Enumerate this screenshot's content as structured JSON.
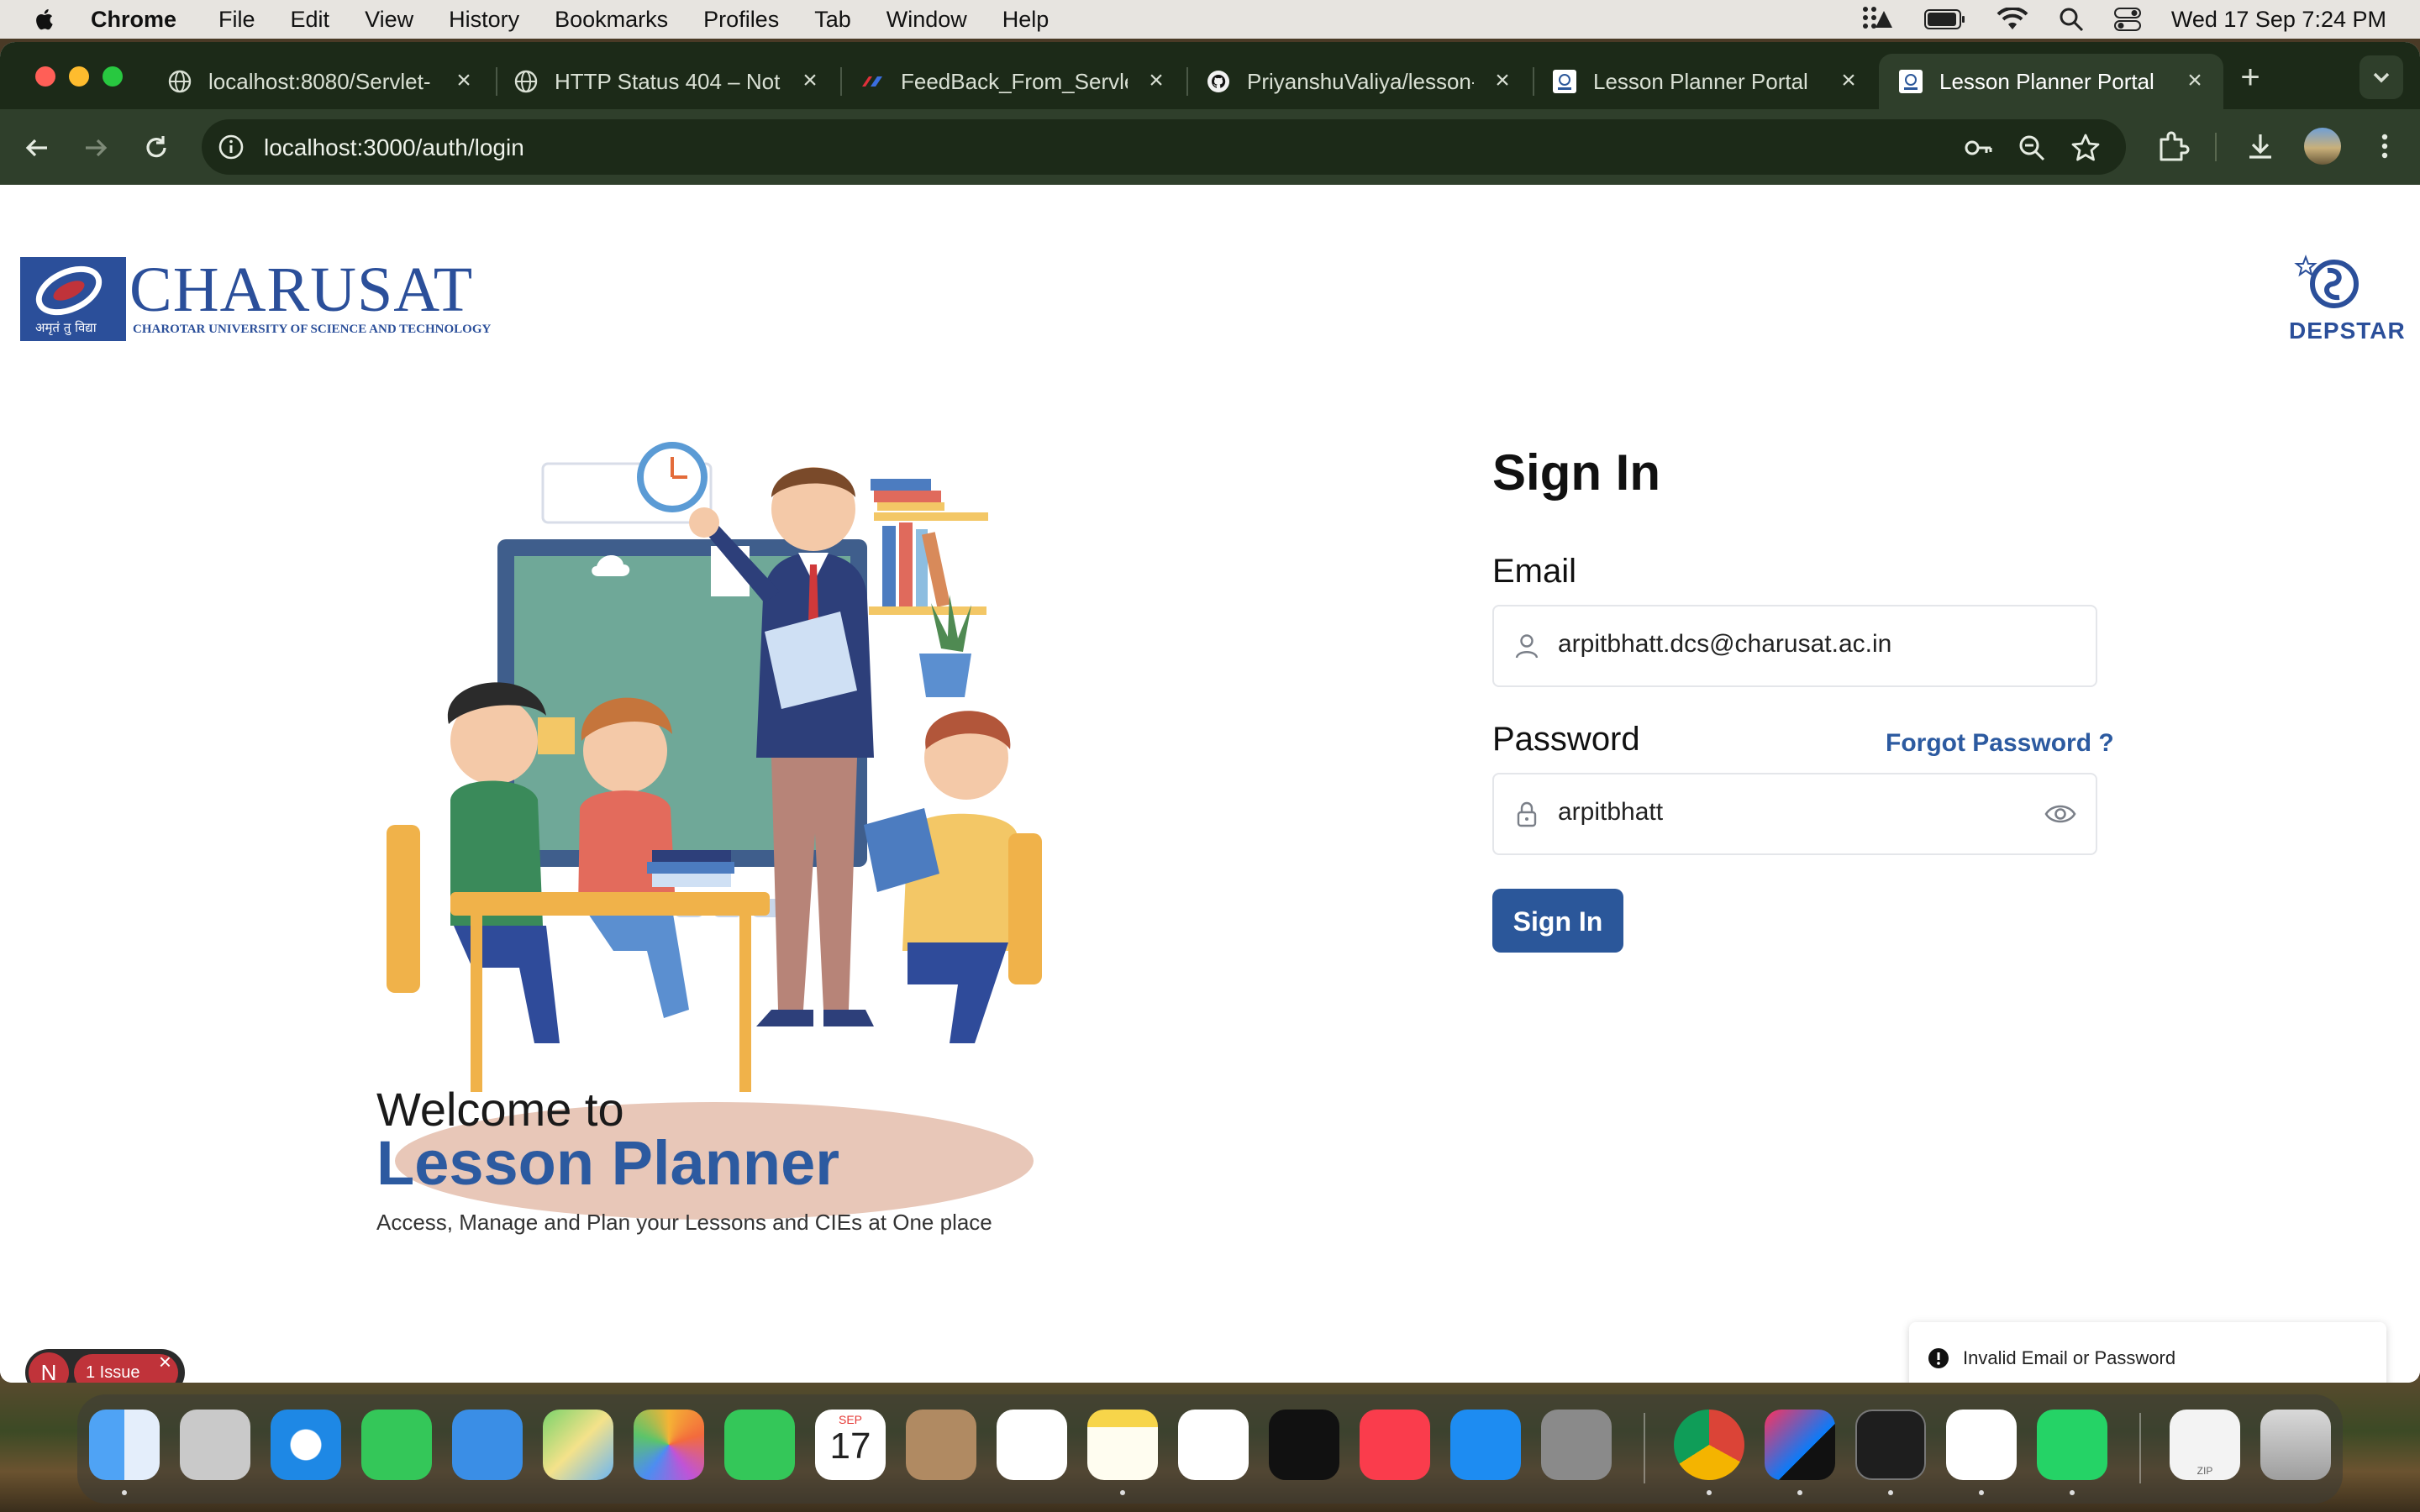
{
  "menubar": {
    "app_name": "Chrome",
    "menus": [
      "File",
      "Edit",
      "View",
      "History",
      "Bookmarks",
      "Profiles",
      "Tab",
      "Window",
      "Help"
    ],
    "clock": "Wed 17 Sep  7:24 PM"
  },
  "tabs": [
    {
      "title": "localhost:8080/Servlet-",
      "icon": "globe-icon",
      "active": false
    },
    {
      "title": "HTTP Status 404 – Not",
      "icon": "globe-icon",
      "active": false
    },
    {
      "title": "FeedBack_From_Servle",
      "icon": "feedback-favicon",
      "active": false
    },
    {
      "title": "PriyanshuValiya/lesson-",
      "icon": "github-icon",
      "active": false
    },
    {
      "title": "Lesson Planner Portal",
      "icon": "depstar-favicon",
      "active": false
    },
    {
      "title": "Lesson Planner Portal",
      "icon": "depstar-favicon",
      "active": true
    }
  ],
  "address_bar": {
    "url": "localhost:3000/auth/login"
  },
  "page": {
    "brand": {
      "charusat_name": "CHARUSAT",
      "charusat_subtitle": "CHAROTAR UNIVERSITY OF SCIENCE AND TECHNOLOGY",
      "charusat_motto": "अमृतं तु विद्या",
      "depstar_name": "DEPSTAR"
    },
    "hero": {
      "welcome": "Welcome to",
      "title": "Lesson Planner",
      "tagline": "Access, Manage and Plan your Lessons and CIEs at One place"
    },
    "form": {
      "heading": "Sign In",
      "email_label": "Email",
      "email_value": "arpitbhatt.dcs@charusat.ac.in",
      "password_label": "Password",
      "forgot_label": "Forgot Password ?",
      "password_value": "arpitbhatt",
      "submit_label": "Sign In"
    },
    "toast": {
      "message": "Invalid Email or Password"
    },
    "issues": {
      "avatar": "N",
      "badge": "1 Issue"
    }
  },
  "dock": {
    "apps": [
      "finder",
      "launchpad",
      "safari",
      "messages",
      "mail",
      "maps",
      "photos",
      "facetime",
      "calendar",
      "contacts",
      "reminders",
      "notes",
      "freeform",
      "apple-tv",
      "music",
      "app-store",
      "system-settings",
      "chrome",
      "intellij",
      "terminal",
      "vscode",
      "whatsapp",
      "archive",
      "trash"
    ],
    "calendar_month": "SEP",
    "calendar_day": "17",
    "archive_label": "ZIP"
  },
  "colors": {
    "brand_blue": "#2b579a",
    "tab_bg": "#1c2a18",
    "toolbar_bg": "#2f3f2b"
  }
}
